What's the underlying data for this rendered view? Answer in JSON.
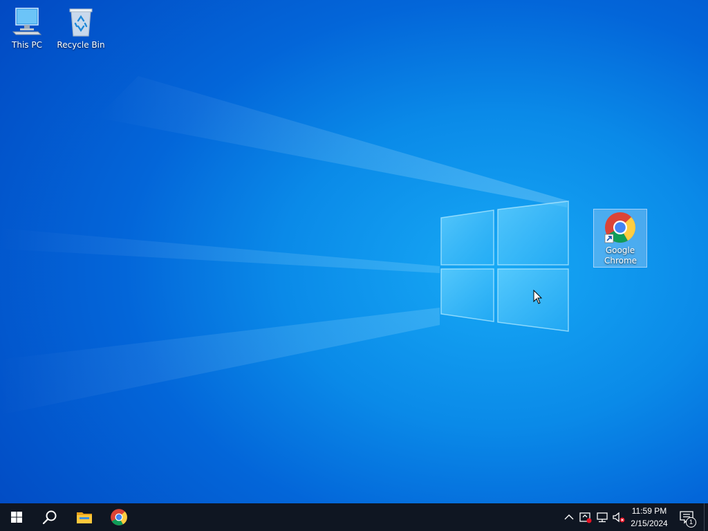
{
  "desktop": {
    "icons": [
      {
        "label": "This PC",
        "icon": "this-pc-icon"
      },
      {
        "label": "Recycle Bin",
        "icon": "recycle-bin-icon"
      },
      {
        "label": "Google Chrome",
        "icon": "chrome-icon",
        "shortcut": true,
        "selected": true
      }
    ],
    "wallpaper": "windows-10-default",
    "colors": {
      "wallpaper_light": "#17a9f5",
      "wallpaper_dark": "#0249c2",
      "taskbar": "#0f1622"
    }
  },
  "taskbar": {
    "buttons": [
      {
        "name": "start-button",
        "icon": "windows-logo-icon"
      },
      {
        "name": "search-button",
        "icon": "search-icon"
      },
      {
        "name": "file-explorer-button",
        "icon": "folder-icon"
      },
      {
        "name": "chrome-taskbar-button",
        "icon": "chrome-icon"
      }
    ],
    "tray": {
      "icons": [
        "chevron-up-icon",
        "security-icon",
        "network-icon",
        "volume-muted-icon"
      ],
      "time": "11:59 PM",
      "date": "2/15/2024",
      "notification_count": "1"
    }
  }
}
